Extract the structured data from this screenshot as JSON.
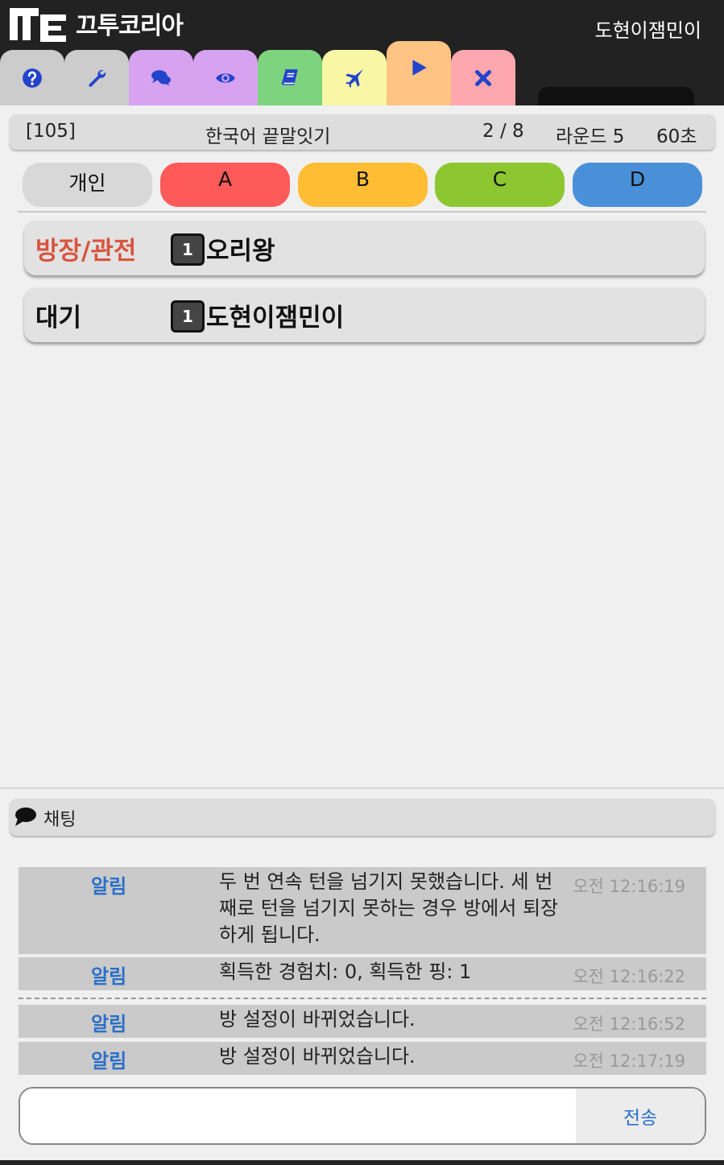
{
  "header": {
    "logo_text": "끄투코리아",
    "username": "도현이잼민이",
    "tabs": [
      {
        "icon": "help-icon",
        "color": "#cccccc"
      },
      {
        "icon": "wrench-icon",
        "color": "#cccccc"
      },
      {
        "icon": "chat-icon",
        "color": "#d7a3f0"
      },
      {
        "icon": "eye-icon",
        "color": "#d7a3f0"
      },
      {
        "icon": "book-icon",
        "color": "#7ed37e"
      },
      {
        "icon": "plane-icon",
        "color": "#f9f7a6"
      },
      {
        "icon": "play-icon",
        "color": "#ffc383"
      },
      {
        "icon": "close-icon",
        "color": "#ffa7ae"
      }
    ]
  },
  "room": {
    "id": "[105]",
    "mode": "한국어 끝말잇기",
    "players": "2 / 8",
    "round": "라운드 5",
    "time": "60초"
  },
  "teams": [
    {
      "label": "개인",
      "color": "#d8d8d8"
    },
    {
      "label": "A",
      "color": "#ff5a5a"
    },
    {
      "label": "B",
      "color": "#ffbd33"
    },
    {
      "label": "C",
      "color": "#8cc630"
    },
    {
      "label": "D",
      "color": "#4a90d9"
    }
  ],
  "groups": [
    {
      "label": "방장/관전",
      "label_color": "#d9533d",
      "level": "1",
      "name": "오리왕"
    },
    {
      "label": "대기",
      "label_color": "#111111",
      "level": "1",
      "name": "도현이잼민이"
    }
  ],
  "chat": {
    "title": "채팅",
    "messages": [
      {
        "sender": "알림",
        "text": "두 번 연속 턴을 넘기지 못했습니다. 세 번째로 턴을 넘기지 못하는 경우 방에서 퇴장하게 됩니다.",
        "time": "오전 12:16:19"
      },
      {
        "sender": "알림",
        "text": "획득한 경험치: 0, 획득한 핑: 1",
        "time": "오전 12:16:22"
      },
      {
        "sender": "알림",
        "text": "방 설정이 바뀌었습니다.",
        "time": "오전 12:16:52"
      },
      {
        "sender": "알림",
        "text": "방 설정이 바뀌었습니다.",
        "time": "오전 12:17:19"
      }
    ],
    "input_value": "",
    "send_label": "전송"
  }
}
